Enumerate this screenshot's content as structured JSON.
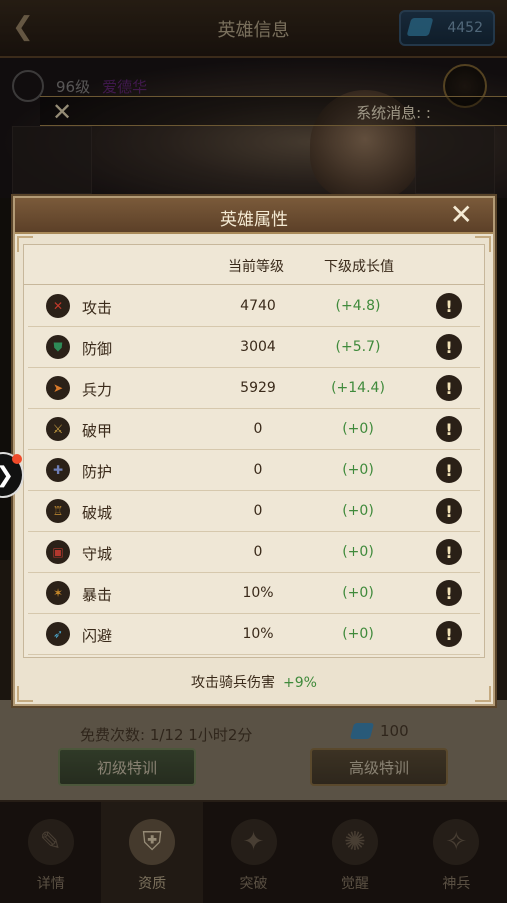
{
  "top_bar": {
    "title": "英雄信息",
    "gems": "4452"
  },
  "hero": {
    "level": "96级",
    "name": "爱德华"
  },
  "system_message": {
    "label": "系统消息: :"
  },
  "modal": {
    "title": "英雄属性",
    "headers": {
      "current_level": "当前等级",
      "next_growth": "下级成长值"
    },
    "rows": [
      {
        "icon": "attack-icon",
        "name": "攻击",
        "current": "4740",
        "next": "(+4.8)",
        "color": "#c0392b"
      },
      {
        "icon": "defense-icon",
        "name": "防御",
        "current": "3004",
        "next": "(+5.7)",
        "color": "#2e8b57"
      },
      {
        "icon": "troops-icon",
        "name": "兵力",
        "current": "5929",
        "next": "(+14.4)",
        "color": "#d97a2b"
      },
      {
        "icon": "armor-break-icon",
        "name": "破甲",
        "current": "0",
        "next": "(+0)",
        "color": "#caa042"
      },
      {
        "icon": "protection-icon",
        "name": "防护",
        "current": "0",
        "next": "(+0)",
        "color": "#6f7fb8"
      },
      {
        "icon": "siege-icon",
        "name": "破城",
        "current": "0",
        "next": "(+0)",
        "color": "#c99234"
      },
      {
        "icon": "city-defense-icon",
        "name": "守城",
        "current": "0",
        "next": "(+0)",
        "color": "#b2382e"
      },
      {
        "icon": "critical-icon",
        "name": "暴击",
        "current": "10%",
        "next": "(+0)",
        "color": "#c98a2a"
      },
      {
        "icon": "dodge-icon",
        "name": "闪避",
        "current": "10%",
        "next": "(+0)",
        "color": "#4aa3c7"
      }
    ],
    "footer": {
      "label": "攻击骑兵伤害",
      "bonus": "+9%"
    }
  },
  "training": {
    "free_count": "免费次数: 1/12   1小时2分",
    "cost": "100",
    "basic_label": "初级特训",
    "advanced_label": "高级特训"
  },
  "tabs": [
    {
      "label": "详情",
      "icon": "details-icon",
      "active": false
    },
    {
      "label": "资质",
      "icon": "helmet-icon",
      "active": true
    },
    {
      "label": "突破",
      "icon": "breakthrough-icon",
      "active": false
    },
    {
      "label": "觉醒",
      "icon": "awaken-icon",
      "active": false
    },
    {
      "label": "神兵",
      "icon": "weapon-icon",
      "active": false
    }
  ]
}
